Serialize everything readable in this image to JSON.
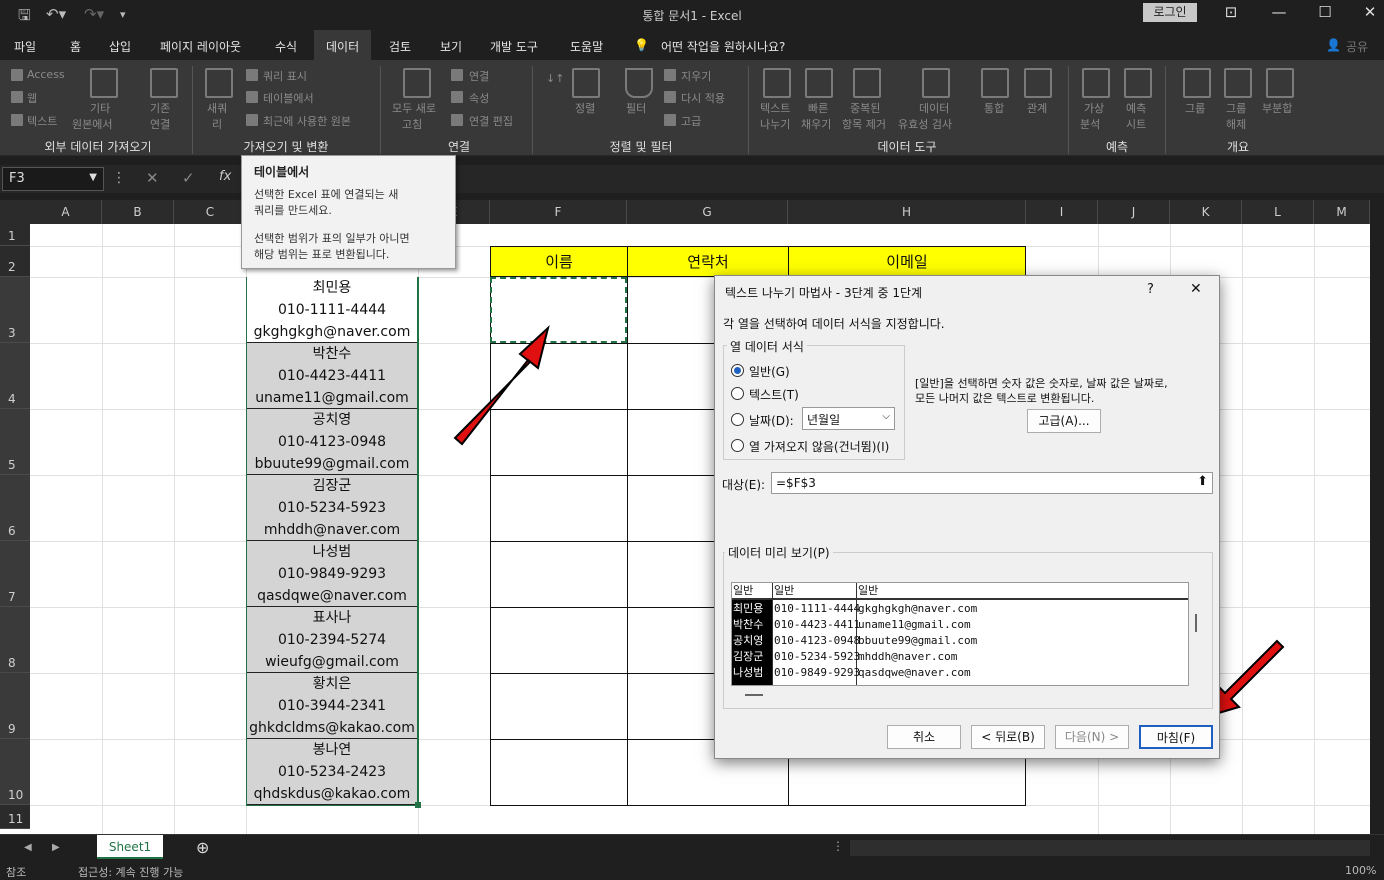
{
  "window": {
    "title": "통합 문서1  -  Excel",
    "login": "로그인"
  },
  "tabs": [
    "파일",
    "홈",
    "삽입",
    "페이지 레이아웃",
    "수식",
    "데이터",
    "검토",
    "보기",
    "개발 도구",
    "도움말"
  ],
  "tell_me": "어떤 작업을 원하시나요?",
  "share": "공유",
  "ribbon": {
    "access": "Access",
    "web": "웹",
    "text": "텍스트",
    "other1": "기타",
    "other2": "원본에서",
    "existing1": "기존",
    "existing2": "연결",
    "new1": "새쿼",
    "new2": "리",
    "show_query": "쿼리 표시",
    "from_table": "테이블에서",
    "recent": "최근에 사용한 원본",
    "refresh1": "모두 새로",
    "refresh2": "고침",
    "conn": "연결",
    "props": "속성",
    "edit_links": "연결 편집",
    "sort": "정렬",
    "filter": "필터",
    "clear": "지우기",
    "reapply": "다시 적용",
    "advanced": "고급",
    "t2c1": "텍스트",
    "t2c2": "나누기",
    "flash1": "빠른",
    "flash2": "채우기",
    "dup1": "중복된",
    "dup2": "항목 제거",
    "dv1": "데이터",
    "dv2": "유효성 검사",
    "consol": "통합",
    "rel": "관계",
    "whatif1": "가상",
    "whatif2": "분석",
    "forecast1": "예측",
    "forecast2": "시트",
    "group": "그룹",
    "ungroup1": "그룹",
    "ungroup2": "해제",
    "subtotal": "부분합",
    "groups": [
      "외부 데이터 가져오기",
      "가져오기 및 변환",
      "연결",
      "정렬 및 필터",
      "데이터 도구",
      "예측",
      "개요"
    ]
  },
  "namebox": "F3",
  "columns": [
    "A",
    "B",
    "C",
    "D",
    "E",
    "F",
    "G",
    "H",
    "I",
    "J",
    "K",
    "L",
    "M"
  ],
  "rows": [
    "1",
    "2",
    "3",
    "4",
    "5",
    "6",
    "7",
    "8",
    "9",
    "10",
    "11"
  ],
  "tooltip": {
    "title": "테이블에서",
    "line1": "선택한 Excel 표에 연결되는 새",
    "line2": "쿼리를 만드세요.",
    "line3": "선택한 범위가 표의 일부가 아니면",
    "line4": "해당 범위는 표로 변환됩니다."
  },
  "headers": {
    "name": "이름",
    "contact": "연락처",
    "email": "이메일"
  },
  "entries": [
    {
      "name": "최민용",
      "phone": "010-1111-4444",
      "email": "gkghgkgh@naver.com"
    },
    {
      "name": "박찬수",
      "phone": "010-4423-4411",
      "email": "uname11@gmail.com"
    },
    {
      "name": "공치영",
      "phone": "010-4123-0948",
      "email": "bbuute99@gmail.com"
    },
    {
      "name": "김장군",
      "phone": "010-5234-5923",
      "email": "mhddh@naver.com"
    },
    {
      "name": "나성범",
      "phone": "010-9849-9293",
      "email": "qasdqwe@naver.com"
    },
    {
      "name": "표사나",
      "phone": "010-2394-5274",
      "email": "wieufg@gmail.com"
    },
    {
      "name": "황치은",
      "phone": "010-3944-2341",
      "email": "ghkdcldms@kakao.com"
    },
    {
      "name": "봉나연",
      "phone": "010-5234-2423",
      "email": "qhdskdus@kakao.com"
    }
  ],
  "dialog": {
    "title": "텍스트 나누기 마법사 - 3단계 중 1단계",
    "help": "?",
    "close": "✕",
    "instruction": "각 열을 선택하여 데이터 서식을 지정합니다.",
    "format_group": "열 데이터 서식",
    "opt_general": "일반(G)",
    "opt_text": "텍스트(T)",
    "opt_date": "날짜(D):",
    "date_value": "년월일",
    "opt_skip": "열 가져오지 않음(건너뜀)(I)",
    "desc1": "[일반]을 선택하면 숫자 값은 숫자로, 날짜 값은 날짜로,",
    "desc2": "모든 나머지 값은 텍스트로 변환됩니다.",
    "advanced": "고급(A)...",
    "dest_label": "대상(E):",
    "dest_value": "=$F$3",
    "preview_label": "데이터 미리 보기(P)",
    "preview_headers": [
      "일반",
      "일반",
      "일반"
    ],
    "preview_rows": [
      [
        "최민용",
        "010-1111-4444",
        "gkghgkgh@naver.com"
      ],
      [
        "박찬수",
        "010-4423-4411",
        "uname11@gmail.com"
      ],
      [
        "공치영",
        "010-4123-0948",
        "bbuute99@gmail.com"
      ],
      [
        "김장군",
        "010-5234-5923",
        "mhddh@naver.com"
      ],
      [
        "나성범",
        "010-9849-9293",
        "qasdqwe@naver.com"
      ]
    ],
    "cancel": "취소",
    "back": "< 뒤로(B)",
    "next": "다음(N) >",
    "finish": "마침(F)"
  },
  "sheet": "Sheet1",
  "status": {
    "ready": "참조",
    "access": "접근성: 계속 진행 가능",
    "zoom": "100%"
  }
}
